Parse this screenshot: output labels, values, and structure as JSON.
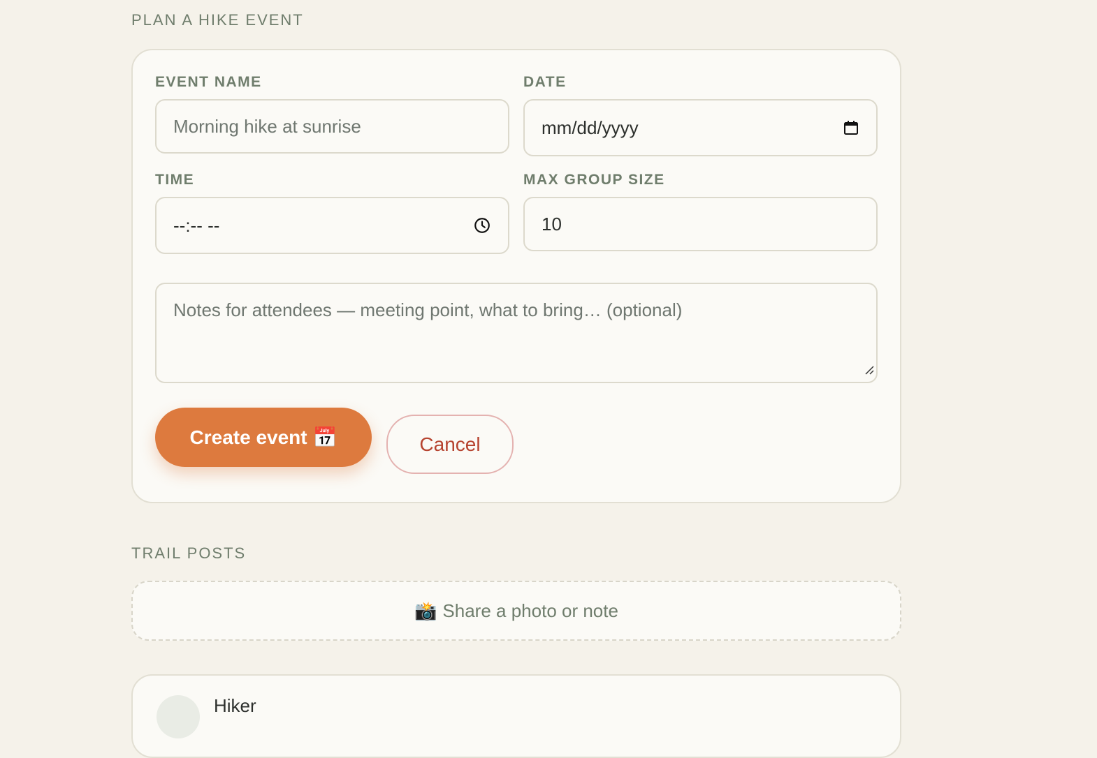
{
  "sections": {
    "plan_event_title": "PLAN A HIKE EVENT",
    "trail_posts_title": "TRAIL POSTS"
  },
  "form": {
    "event_name": {
      "label": "EVENT NAME",
      "placeholder": "Morning hike at sunrise"
    },
    "date": {
      "label": "DATE",
      "value": "mm/dd/yyyy",
      "icon": "calendar-icon"
    },
    "time": {
      "label": "TIME",
      "value": "--:-- --",
      "icon": "clock-icon"
    },
    "max_group_size": {
      "label": "MAX GROUP SIZE",
      "value": "10"
    },
    "notes": {
      "placeholder": "Notes for attendees — meeting point, what to bring… (optional)"
    },
    "create_button": {
      "label": "Create event",
      "emoji": "📅"
    },
    "cancel_button": {
      "label": "Cancel"
    }
  },
  "share": {
    "emoji": "📸",
    "label": "Share a photo or note"
  },
  "post": {
    "author": "Hiker"
  },
  "colors": {
    "background": "#f5f2ea",
    "card": "#fbfaf6",
    "accent_orange": "#dd7a3e",
    "cancel_red": "#b6432f",
    "label_green": "#6f7d6c"
  }
}
